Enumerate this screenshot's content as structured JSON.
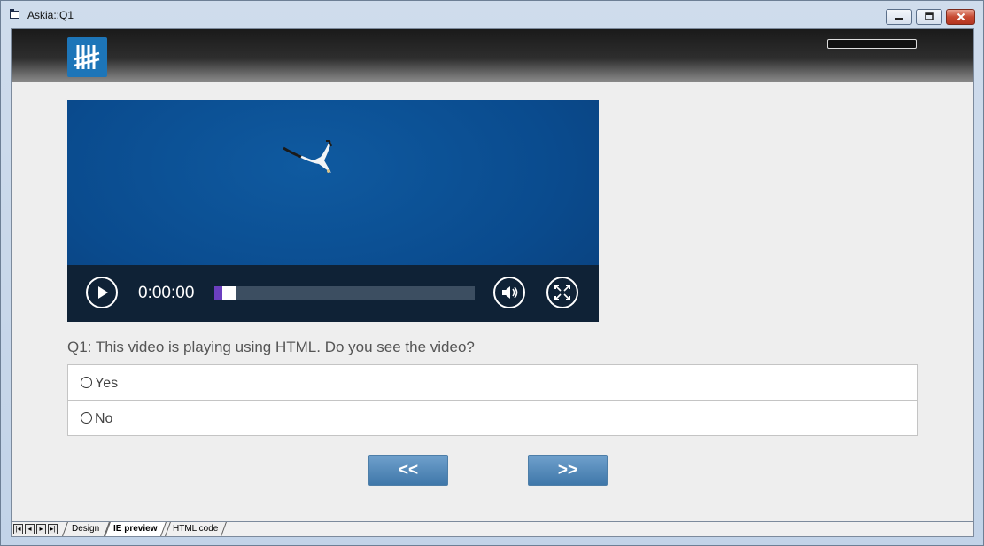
{
  "window": {
    "title": "Askia::Q1",
    "minimize_icon": "minimize-icon",
    "maximize_icon": "maximize-icon",
    "close_icon": "close-icon"
  },
  "header": {
    "logo_icon": "askia-tally-logo",
    "logo_color": "#1d75b8"
  },
  "video": {
    "time": "0:00:00",
    "progress": 0.03,
    "play_icon": "play-icon",
    "volume_icon": "volume-icon",
    "fullscreen_icon": "fullscreen-icon",
    "accent_color": "#6b3fbf"
  },
  "question": {
    "text": "Q1: This video is playing using HTML. Do you see the video?",
    "answers": [
      {
        "label": "Yes"
      },
      {
        "label": "No"
      }
    ]
  },
  "navigation": {
    "previous_label": "<<",
    "next_label": ">>"
  },
  "tabs": {
    "items": [
      {
        "label": "Design"
      },
      {
        "label": "IE preview"
      },
      {
        "label": "HTML code"
      }
    ],
    "active": "IE preview"
  }
}
